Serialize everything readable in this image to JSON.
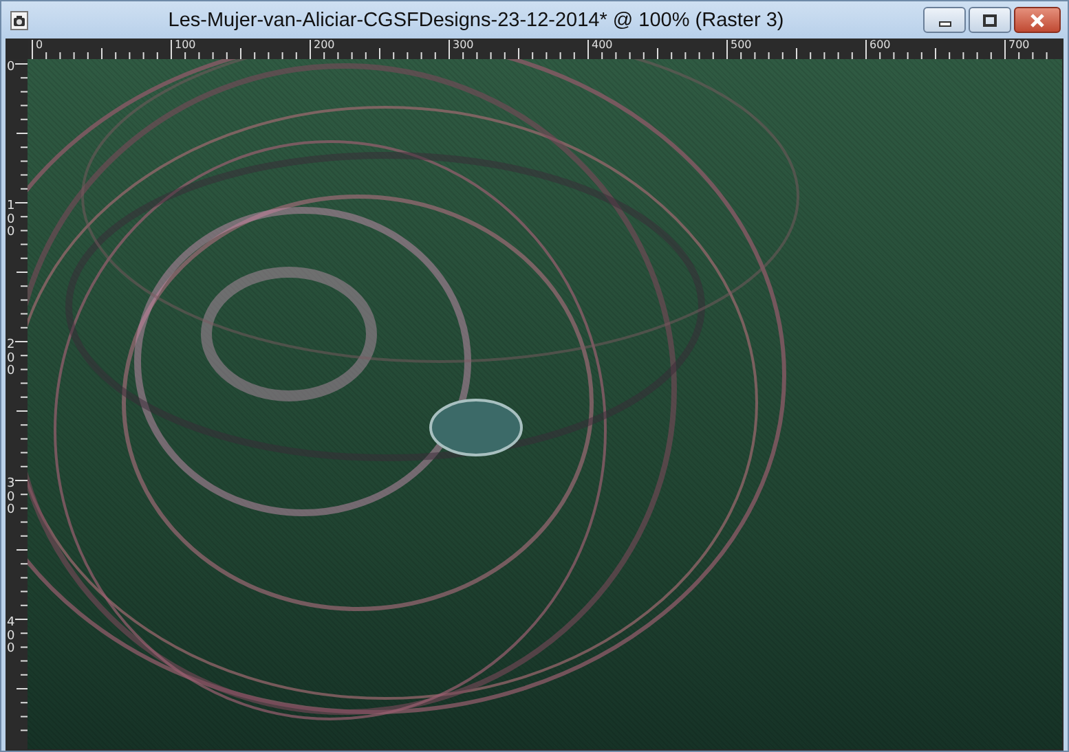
{
  "window": {
    "title": "Les-Mujer-van-Aliciar-CGSFDesigns-23-12-2014* @ 100% (Raster 3)"
  },
  "rulers": {
    "horizontal": [
      "0",
      "100",
      "200",
      "300",
      "400",
      "500",
      "600",
      "700"
    ],
    "vertical": [
      "0",
      "100",
      "200",
      "300",
      "400"
    ]
  }
}
